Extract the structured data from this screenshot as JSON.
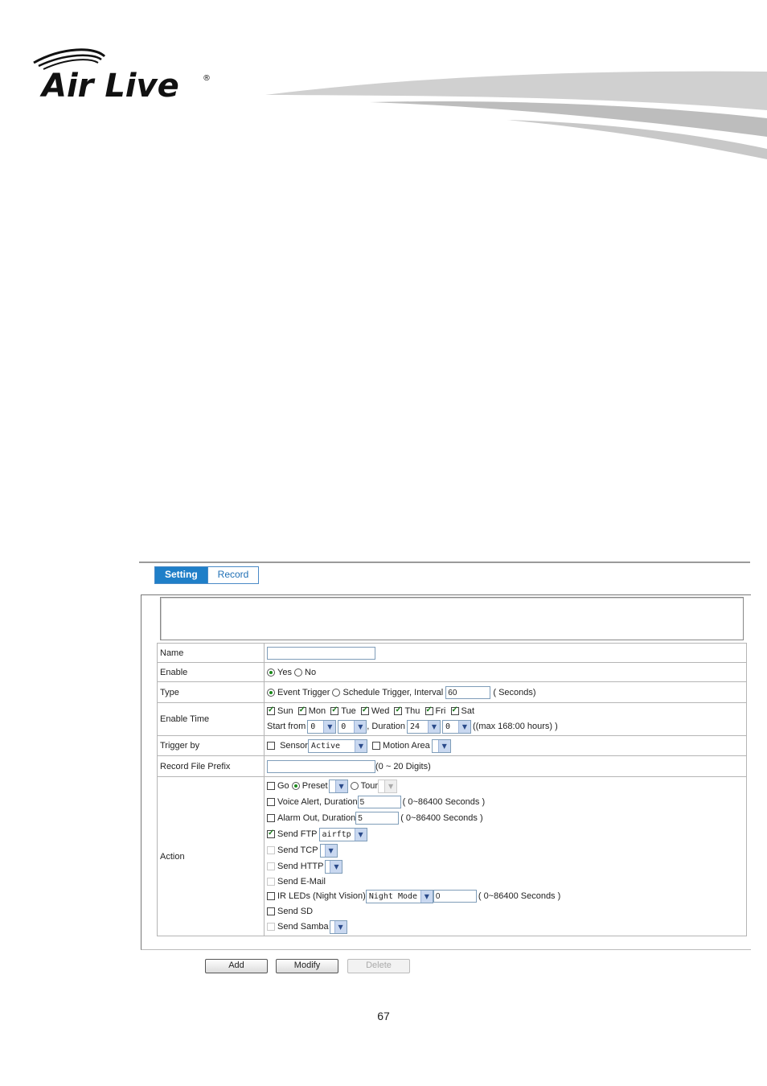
{
  "brand": {
    "name": "Air Live",
    "registered": "®"
  },
  "tabs": [
    {
      "label": "Setting",
      "active": true
    },
    {
      "label": "Record",
      "active": false
    }
  ],
  "form": {
    "name": {
      "label": "Name",
      "value": ""
    },
    "enable": {
      "label": "Enable",
      "yes": "Yes",
      "no": "No",
      "selected": "Yes"
    },
    "type": {
      "label": "Type",
      "event": "Event Trigger",
      "schedule": "Schedule Trigger, Interval",
      "interval": "60",
      "unit": "( Seconds)",
      "selected": "Event Trigger"
    },
    "enable_time": {
      "label": "Enable Time",
      "days": [
        "Sun",
        "Mon",
        "Tue",
        "Wed",
        "Thu",
        "Fri",
        "Sat"
      ],
      "start_label": "Start from",
      "start_h": "0",
      "start_m": "0",
      "duration_label": ", Duration",
      "dur_h": "24",
      "dur_m": "0",
      "max_note": "((max 168:00 hours) )"
    },
    "trigger_by": {
      "label": "Trigger by",
      "sensor": "Sensor",
      "sensor_value": "Active",
      "motion": "Motion Area"
    },
    "prefix": {
      "label": "Record File Prefix",
      "value": "",
      "note": "(0 ~ 20 Digits)"
    },
    "action": {
      "label": "Action",
      "go": "Go",
      "preset": "Preset",
      "tour": "Tour",
      "voice": "Voice Alert, Duration",
      "voice_value": "5",
      "voice_note": "( 0~86400 Seconds )",
      "alarm": "Alarm Out, Duration",
      "alarm_value": "5",
      "alarm_note": "( 0~86400 Seconds )",
      "ftp": "Send FTP",
      "ftp_value": "airftp",
      "tcp": "Send TCP",
      "http": "Send HTTP",
      "email": "Send E-Mail",
      "ir": "IR LEDs (Night Vision)",
      "ir_mode": "Night Mode",
      "ir_value": "0",
      "ir_note": "( 0~86400 Seconds )",
      "sd": "Send SD",
      "samba": "Send Samba"
    }
  },
  "buttons": {
    "add": "Add",
    "modify": "Modify",
    "delete": "Delete"
  },
  "page_number": "67"
}
